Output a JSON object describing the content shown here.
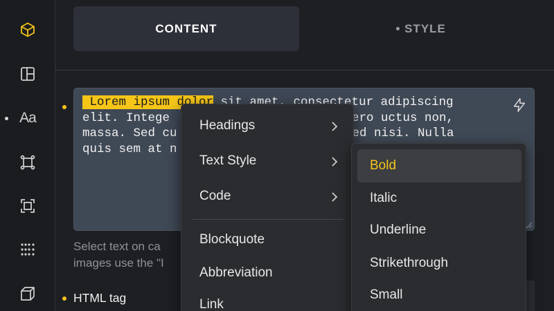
{
  "rail": {
    "items": [
      {
        "icon": "cube-icon",
        "color": "#f5c518"
      },
      {
        "icon": "layout-icon"
      },
      {
        "icon": "typography-icon",
        "label": "Aa"
      },
      {
        "icon": "component-icon"
      },
      {
        "icon": "frame-icon"
      },
      {
        "icon": "grid-dots-icon"
      },
      {
        "icon": "box-3d-icon"
      }
    ]
  },
  "tabs": {
    "content": "CONTENT",
    "style": "STYLE"
  },
  "editor": {
    "highlighted": " Lorem ipsum dolor",
    "line1_rest": " sit amet, consectetur adipiscing",
    "line2": "elit. Intege",
    "line2_right": "ibero uctus non,",
    "line3": "massa. Sed cu",
    "line3_right": "n. Sed nisi. Nulla",
    "line4": "quis sem at n"
  },
  "help": {
    "line1": "Select text on ca",
    "line2": "images use the \"I"
  },
  "fields": {
    "html_tag": "HTML tag"
  },
  "context_menu": {
    "items": [
      {
        "label": "Headings",
        "submenu": true
      },
      {
        "label": "Text Style",
        "submenu": true
      },
      {
        "label": "Code",
        "submenu": true
      },
      {
        "label": "Blockquote"
      },
      {
        "label": "Abbreviation"
      },
      {
        "label": "Link"
      }
    ]
  },
  "submenu": {
    "items": [
      "Bold",
      "Italic",
      "Underline",
      "Strikethrough",
      "Small"
    ],
    "active": "Bold"
  },
  "colors": {
    "accent": "#f5c518",
    "editor_bg": "#3f4855",
    "menu_bg": "#2b2c2f"
  }
}
